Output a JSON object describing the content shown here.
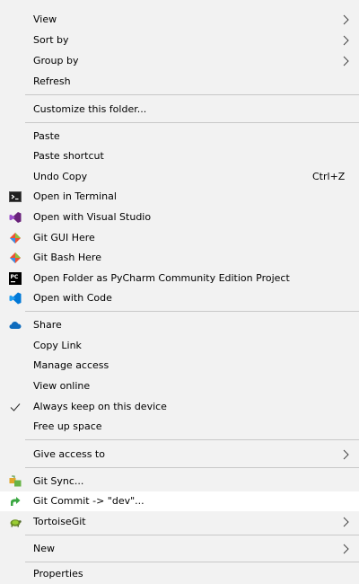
{
  "menu": {
    "items": [
      {
        "label": "View",
        "icon": "",
        "shortcut": "",
        "submenu": true
      },
      {
        "label": "Sort by",
        "icon": "",
        "shortcut": "",
        "submenu": true
      },
      {
        "label": "Group by",
        "icon": "",
        "shortcut": "",
        "submenu": true
      },
      {
        "label": "Refresh",
        "icon": "",
        "shortcut": "",
        "submenu": false
      },
      {
        "label": "Customize this folder...",
        "icon": "",
        "shortcut": "",
        "submenu": false
      },
      {
        "label": "Paste",
        "icon": "",
        "shortcut": "",
        "submenu": false
      },
      {
        "label": "Paste shortcut",
        "icon": "",
        "shortcut": "",
        "submenu": false
      },
      {
        "label": "Undo Copy",
        "icon": "",
        "shortcut": "Ctrl+Z",
        "submenu": false
      },
      {
        "label": "Open in Terminal",
        "icon": "terminal-icon",
        "shortcut": "",
        "submenu": false
      },
      {
        "label": "Open with Visual Studio",
        "icon": "visual-studio-icon",
        "shortcut": "",
        "submenu": false
      },
      {
        "label": "Git GUI Here",
        "icon": "git-gui-icon",
        "shortcut": "",
        "submenu": false
      },
      {
        "label": "Git Bash Here",
        "icon": "git-bash-icon",
        "shortcut": "",
        "submenu": false
      },
      {
        "label": "Open Folder as PyCharm Community Edition Project",
        "icon": "pycharm-icon",
        "shortcut": "",
        "submenu": false
      },
      {
        "label": "Open with Code",
        "icon": "vscode-icon",
        "shortcut": "",
        "submenu": false
      },
      {
        "label": "Share",
        "icon": "onedrive-cloud-icon",
        "shortcut": "",
        "submenu": false
      },
      {
        "label": "Copy Link",
        "icon": "",
        "shortcut": "",
        "submenu": false
      },
      {
        "label": "Manage access",
        "icon": "",
        "shortcut": "",
        "submenu": false
      },
      {
        "label": "View online",
        "icon": "",
        "shortcut": "",
        "submenu": false
      },
      {
        "label": "Always keep on this device",
        "icon": "checkmark-icon",
        "shortcut": "",
        "submenu": false
      },
      {
        "label": "Free up space",
        "icon": "",
        "shortcut": "",
        "submenu": false
      },
      {
        "label": "Give access to",
        "icon": "",
        "shortcut": "",
        "submenu": true
      },
      {
        "label": "Git Sync...",
        "icon": "git-sync-icon",
        "shortcut": "",
        "submenu": false
      },
      {
        "label": "Git Commit -> \"dev\"...",
        "icon": "git-commit-icon",
        "shortcut": "",
        "submenu": false
      },
      {
        "label": "TortoiseGit",
        "icon": "tortoisegit-icon",
        "shortcut": "",
        "submenu": true
      },
      {
        "label": "New",
        "icon": "",
        "shortcut": "",
        "submenu": true
      },
      {
        "label": "Properties",
        "icon": "",
        "shortcut": "",
        "submenu": false
      }
    ]
  },
  "colors": {
    "menu_background": "#f2f2f2",
    "highlight": "#ffffff",
    "separator": "#c8c8c8",
    "onedrive_blue": "#0f6cbd",
    "vs_purple": "#68217a",
    "git_orange": "#f05133",
    "vscode_blue": "#0078d7"
  }
}
